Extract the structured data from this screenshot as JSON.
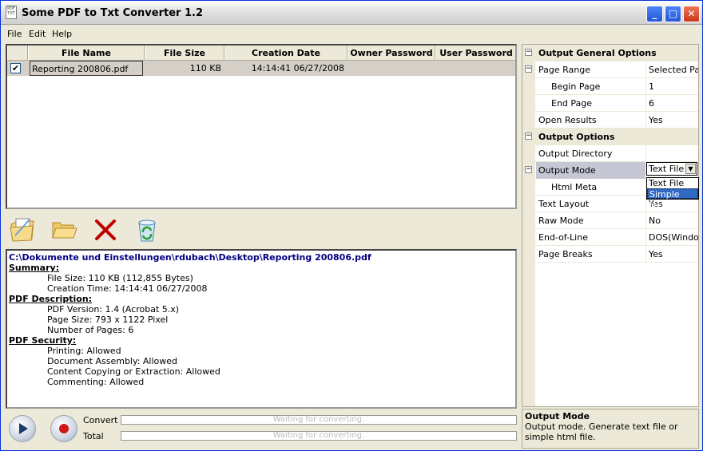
{
  "window": {
    "title": "Some PDF to Txt Converter 1.2",
    "icon_text": "PDF TXT",
    "min_label": "_",
    "max_label": "□",
    "close_label": "✕"
  },
  "menu": {
    "file": "File",
    "edit": "Edit",
    "help": "Help"
  },
  "file_list": {
    "columns": [
      "File Name",
      "File Size",
      "Creation Date",
      "Owner Password",
      "User Password"
    ],
    "rows": [
      {
        "checked": "✔",
        "name": "Reporting 200806.pdf",
        "size": "110 KB",
        "date": "14:14:41 06/27/2008",
        "owner_password": "",
        "user_password": ""
      }
    ]
  },
  "toolbar": {
    "icons": [
      "add-file-icon",
      "open-folder-icon",
      "delete-icon",
      "clear-list-icon"
    ]
  },
  "info": {
    "path": "C:\\Dokumente und Einstellungen\\rdubach\\Desktop\\Reporting 200806.pdf",
    "summary_title": "Summary:",
    "file_size": "File Size: 110 KB (112,855 Bytes)",
    "creation_time": "Creation Time: 14:14:41 06/27/2008",
    "description_title": "PDF Description:",
    "pdf_version": "PDF Version: 1.4 (Acrobat 5.x)",
    "page_size": "Page Size: 793 x 1122 Pixel",
    "num_pages": "Number of Pages: 6",
    "security_title": "PDF Security:",
    "printing": "Printing: Allowed",
    "assembly": "Document Assembly: Allowed",
    "copying": "Content Copying or Extraction: Allowed",
    "commenting": "Commenting: Allowed"
  },
  "progress": {
    "convert_label": "Convert",
    "total_label": "Total",
    "convert_status": "Waiting for converting.",
    "total_status": "Waiting for converting."
  },
  "properties": {
    "general_title": "Output General Options",
    "page_range_label": "Page Range",
    "page_range_value": "Selected Pages",
    "begin_page_label": "Begin Page",
    "begin_page_value": "1",
    "end_page_label": "End Page",
    "end_page_value": "6",
    "open_results_label": "Open Results",
    "open_results_value": "Yes",
    "output_title": "Output Options",
    "output_dir_label": "Output Directory",
    "output_dir_value": "",
    "output_mode_label": "Output Mode",
    "output_mode_value": "Text File",
    "output_mode_options": [
      "Text File",
      "Simple HTML"
    ],
    "html_meta_label": "Html Meta",
    "text_layout_label": "Text Layout",
    "text_layout_value": "Yes",
    "raw_mode_label": "Raw Mode",
    "raw_mode_value": "No",
    "eol_label": "End-of-Line",
    "eol_value": "DOS(Windows)",
    "page_breaks_label": "Page Breaks",
    "page_breaks_value": "Yes"
  },
  "description": {
    "title": "Output Mode",
    "text": "Output mode. Generate text file or simple html file."
  }
}
